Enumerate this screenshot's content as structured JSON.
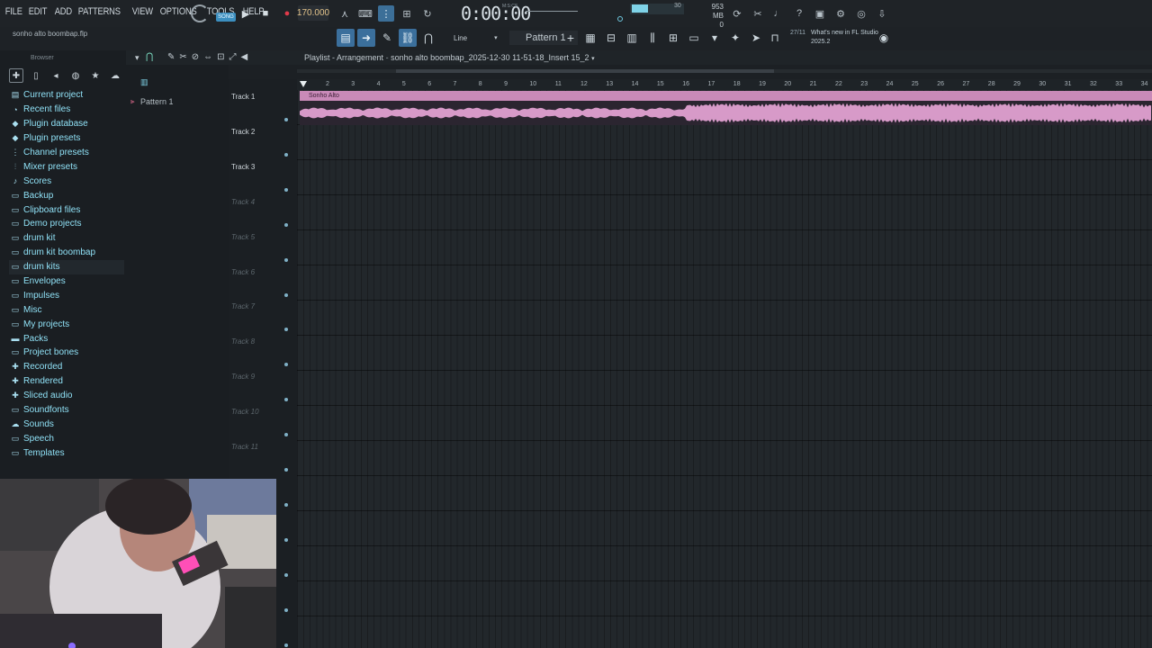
{
  "menu": [
    "FILE",
    "EDIT",
    "ADD",
    "PATTERNS",
    "VIEW",
    "OPTIONS",
    "TOOLS",
    "HELP"
  ],
  "transport": {
    "mode": "SONG",
    "tempo": "170.000",
    "time": "0:00:00",
    "time_unit": "M:S:CS",
    "cpu_value": "30",
    "memory": "953 MB",
    "voices": "0",
    "cpu_level": 0.3
  },
  "project": {
    "file": "sonho alto boombap.flp",
    "pattern_selector": "Pattern 1",
    "tool_mode": "Line"
  },
  "news": {
    "count": "27/11",
    "text": "What's new in FL Studio 2025.2"
  },
  "browser": {
    "title": "Browser",
    "items": [
      {
        "label": "Current project",
        "icon": "doc-icon"
      },
      {
        "label": "Recent files",
        "icon": "clock-icon"
      },
      {
        "label": "Plugin database",
        "icon": "plug-icon"
      },
      {
        "label": "Plugin presets",
        "icon": "plug-icon"
      },
      {
        "label": "Channel presets",
        "icon": "channel-icon"
      },
      {
        "label": "Mixer presets",
        "icon": "mixer-icon"
      },
      {
        "label": "Scores",
        "icon": "note-icon"
      },
      {
        "label": "Backup",
        "icon": "folder-icon"
      },
      {
        "label": "Clipboard files",
        "icon": "folder-icon"
      },
      {
        "label": "Demo projects",
        "icon": "folder-icon"
      },
      {
        "label": "drum kit",
        "icon": "folder-icon"
      },
      {
        "label": "drum kit boombap",
        "icon": "folder-icon"
      },
      {
        "label": "drum kits",
        "icon": "folder-icon"
      },
      {
        "label": "Envelopes",
        "icon": "folder-icon"
      },
      {
        "label": "Impulses",
        "icon": "folder-icon"
      },
      {
        "label": "Misc",
        "icon": "folder-icon"
      },
      {
        "label": "My projects",
        "icon": "folder-icon"
      },
      {
        "label": "Packs",
        "icon": "packs-icon"
      },
      {
        "label": "Project bones",
        "icon": "folder-icon"
      },
      {
        "label": "Recorded",
        "icon": "plus-icon"
      },
      {
        "label": "Rendered",
        "icon": "plus-icon"
      },
      {
        "label": "Sliced audio",
        "icon": "plus-icon"
      },
      {
        "label": "Soundfonts",
        "icon": "folder-icon"
      },
      {
        "label": "Sounds",
        "icon": "cloud-icon"
      },
      {
        "label": "Speech",
        "icon": "folder-icon"
      },
      {
        "label": "Templates",
        "icon": "folder-icon"
      }
    ]
  },
  "picker": {
    "pattern": "Pattern 1"
  },
  "playlist": {
    "title": "Playlist - Arrangement",
    "arrangement": "sonho alto boombap_2025-12-30 11-51-18_Insert 15_2",
    "clip_name": "Sonho Alto",
    "clip_color": "#c98ab8",
    "tracks": [
      "Track 1",
      "Track 2",
      "Track 3",
      "Track 4",
      "Track 5",
      "Track 6",
      "Track 7",
      "Track 8",
      "Track 9",
      "Track 10",
      "Track 11"
    ],
    "bars": [
      "2",
      "3",
      "4",
      "5",
      "6",
      "7",
      "8",
      "9",
      "10",
      "11",
      "12",
      "13",
      "14",
      "15",
      "16",
      "17",
      "18",
      "19",
      "20",
      "21",
      "22",
      "23",
      "24",
      "25",
      "26",
      "27",
      "28",
      "29",
      "30",
      "31",
      "32",
      "33",
      "34"
    ]
  }
}
